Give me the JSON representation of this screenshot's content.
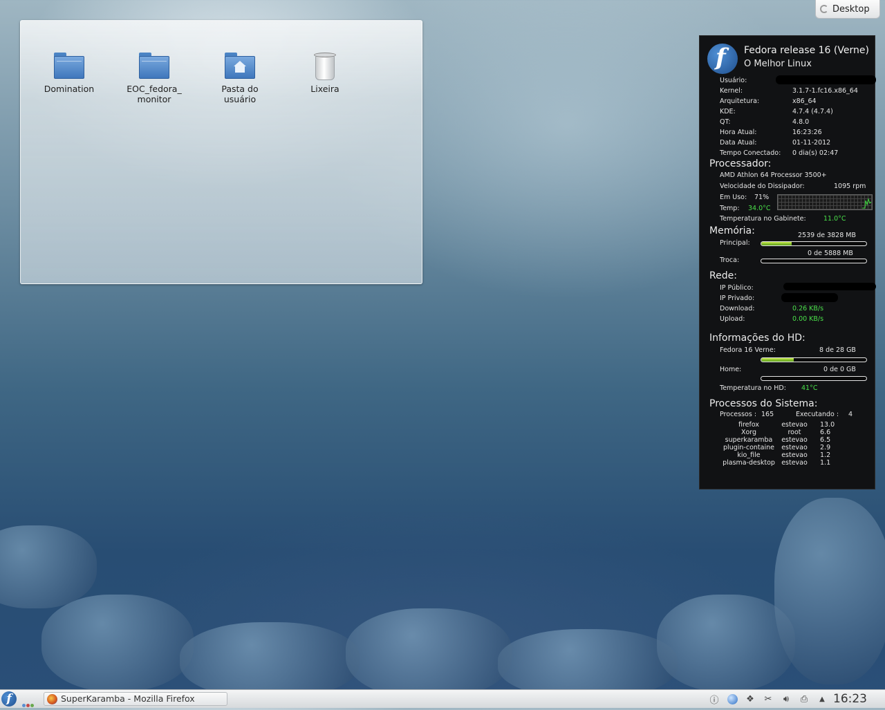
{
  "desktop_button": {
    "label": "Desktop"
  },
  "folder_view": {
    "items": [
      {
        "label": "Domination",
        "icon": "folder-icon"
      },
      {
        "label": "EOC_fedora_ monitor",
        "icon": "folder-icon"
      },
      {
        "label": "Pasta do usuário",
        "icon": "home-folder-icon"
      },
      {
        "label": "Lixeira",
        "icon": "trash-icon"
      }
    ]
  },
  "widget": {
    "title": "Fedora release 16 (Verne)",
    "subtitle": "O Melhor Linux",
    "system": [
      {
        "label": "Usuário:",
        "value": ""
      },
      {
        "label": "Kernel:",
        "value": "3.1.7-1.fc16.x86_64"
      },
      {
        "label": "Arquitetura:",
        "value": "x86_64"
      },
      {
        "label": "KDE:",
        "value": "4.7.4 (4.7.4)"
      },
      {
        "label": "QT:",
        "value": "4.8.0"
      },
      {
        "label": "Hora Atual:",
        "value": "16:23:26"
      },
      {
        "label": "Data Atual:",
        "value": "01-11-2012"
      },
      {
        "label": "Tempo Conectado:",
        "value": "0 dia(s)  02:47"
      }
    ],
    "processor": {
      "heading": "Processador:",
      "model": "AMD Athlon 64 Processor 3500+",
      "fan_label": "Velocidade do Dissipador:",
      "fan_value": "1095  rpm",
      "usage_label": "Em Uso:",
      "usage_value": "71%",
      "temp_label": "Temp:",
      "temp_value": "34.0°C",
      "case_temp_label": "Temperatura no Gabinete:",
      "case_temp_value": "11.0°C"
    },
    "memory": {
      "heading": "Memória:",
      "main_label": "Principal:",
      "main_value": "2539 de 3828 MB",
      "main_fraction": 0.29,
      "swap_label": "Troca:",
      "swap_value": "0 de 5888 MB",
      "swap_fraction": 0
    },
    "network": {
      "heading": "Rede:",
      "public_ip_label": "IP Público:",
      "private_ip_label": "IP Privado:",
      "download_label": "Download:",
      "download_value": "0.26 KB/s",
      "upload_label": "Upload:",
      "upload_value": "0.00 KB/s"
    },
    "disk": {
      "heading": "Informações do HD:",
      "root_label": "Fedora 16 Verne:",
      "root_value": "8 de 28 GB",
      "root_fraction": 0.31,
      "home_label": "Home:",
      "home_value": "0 de 0 GB",
      "home_fraction": 0,
      "temp_label": "Temperatura no HD:",
      "temp_value": "41°C"
    },
    "processes": {
      "heading": "Processos do Sistema:",
      "count_label": "Processos :",
      "count_value": "165",
      "running_label": "Executando :",
      "running_value": "4",
      "list": [
        {
          "name": "firefox",
          "user": "estevao",
          "cpu": "13.0"
        },
        {
          "name": "Xorg",
          "user": "root",
          "cpu": "6.6"
        },
        {
          "name": "superkaramba",
          "user": "estevao",
          "cpu": "6.5"
        },
        {
          "name": "plugin-containe",
          "user": "estevao",
          "cpu": "2.9"
        },
        {
          "name": "kio_file",
          "user": "estevao",
          "cpu": "1.2"
        },
        {
          "name": "plasma-desktop",
          "user": "estevao",
          "cpu": "1.1"
        }
      ]
    }
  },
  "taskbar": {
    "task_label": "SuperKaramba - Mozilla Firefox",
    "clock": "16:23",
    "pager_colors": [
      "#5a8fd0",
      "#c24a4a",
      "#6aa84f"
    ]
  }
}
